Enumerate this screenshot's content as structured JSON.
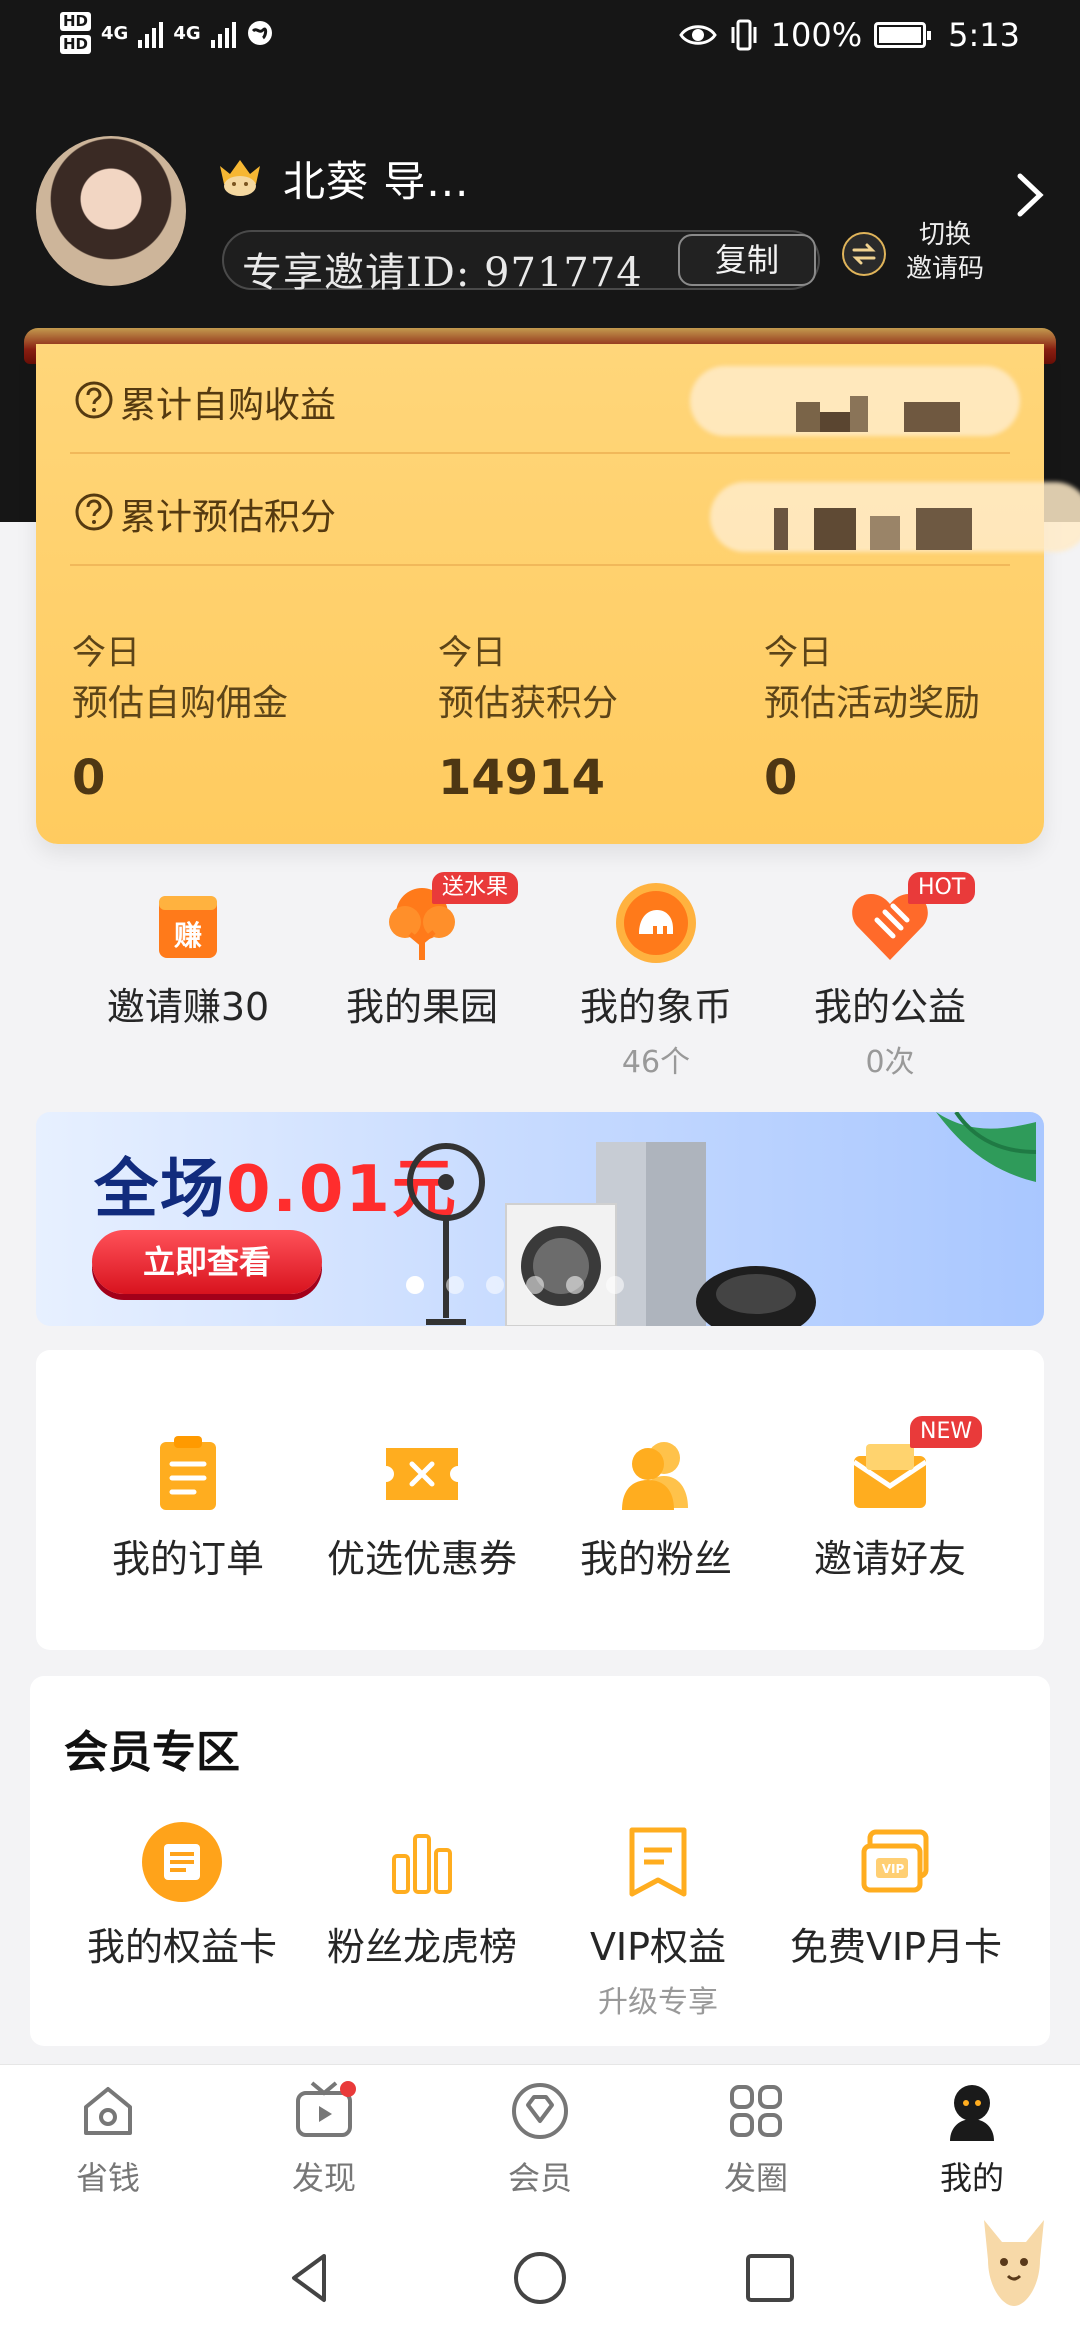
{
  "status_bar": {
    "hd1": "HD",
    "hd2": "HD",
    "net1": "4G",
    "net2": "4G",
    "battery": "100%",
    "time": "5:13"
  },
  "profile": {
    "name": "北葵 导...",
    "invite_id": "专享邀请ID: 971774",
    "copy_label": "复制",
    "switch_label_line1": "切换",
    "switch_label_line2": "邀请码"
  },
  "earnings": {
    "row1_label": "累计自购收益",
    "row2_label": "累计预估积分",
    "stats": [
      {
        "line1": "今日",
        "line2": "预估自购佣金",
        "value": "0"
      },
      {
        "line1": "今日",
        "line2": "预估获积分",
        "value": "14914"
      },
      {
        "line1": "今日",
        "line2": "预估活动奖励",
        "value": "0"
      }
    ]
  },
  "quick_links": [
    {
      "label": "邀请赚30",
      "sub": ""
    },
    {
      "label": "我的果园",
      "sub": "",
      "badge": "送水果"
    },
    {
      "label": "我的象币",
      "sub": "46个"
    },
    {
      "label": "我的公益",
      "sub": "0次",
      "badge": "HOT"
    }
  ],
  "quick_icons": {
    "invite": "赚"
  },
  "banner": {
    "title_prefix": "全场",
    "title_price": "0.01元",
    "button": "立即查看"
  },
  "tools": [
    {
      "label": "我的订单"
    },
    {
      "label": "优选优惠券"
    },
    {
      "label": "我的粉丝"
    },
    {
      "label": "邀请好友",
      "badge": "NEW"
    }
  ],
  "member_zone": {
    "title": "会员专区",
    "items": [
      {
        "label": "我的权益卡",
        "sub": ""
      },
      {
        "label": "粉丝龙虎榜",
        "sub": ""
      },
      {
        "label": "VIP权益",
        "sub": "升级专享"
      },
      {
        "label": "免费VIP月卡",
        "sub": ""
      }
    ],
    "vip_mark": "VIP"
  },
  "tabs": [
    {
      "label": "省钱"
    },
    {
      "label": "发现"
    },
    {
      "label": "会员"
    },
    {
      "label": "发圈"
    },
    {
      "label": "我的"
    }
  ],
  "colors": {
    "header_bg": "#161616",
    "card_gold": "#ffcb5f",
    "accent_orange": "#ffa31a",
    "badge_red": "#e93a3a",
    "page_bg": "#f3f3f5"
  }
}
